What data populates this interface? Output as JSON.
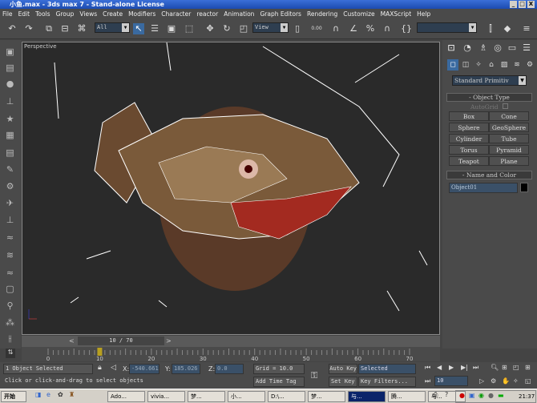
{
  "window": {
    "title": "小鱼.max - 3ds max 7 - Stand-alone License",
    "min": "_",
    "max": "□",
    "close": "X"
  },
  "menu": [
    "File",
    "Edit",
    "Tools",
    "Group",
    "Views",
    "Create",
    "Modifiers",
    "Character",
    "reactor",
    "Animation",
    "Graph Editors",
    "Rendering",
    "Customize",
    "MAXScript",
    "Help"
  ],
  "toolbar": {
    "selection_filter": "All",
    "coord_system": "View",
    "spinner_label": "0.00",
    "named_selection": ""
  },
  "viewport": {
    "label": "Perspective"
  },
  "command_panel": {
    "category": "Standard Primitiv",
    "object_type_title": "Object Type",
    "autogrid": "AutoGrid",
    "buttons": [
      "Box",
      "Cone",
      "Sphere",
      "GeoSphere",
      "Cylinder",
      "Tube",
      "Torus",
      "Pyramid",
      "Teapot",
      "Plane"
    ],
    "name_color_title": "Name and Color",
    "object_name": "Object01",
    "object_color": "#000000"
  },
  "timeline": {
    "frame_label": "10 / 70",
    "ticks": [
      "0",
      "10",
      "20",
      "30",
      "40",
      "50",
      "60",
      "70"
    ],
    "current_frame": 10,
    "total_frames": 70
  },
  "status": {
    "selected": "1 Object Selected",
    "prompt": "Click or click-and-drag to select objects",
    "x_label": "X:",
    "x": "-540.661",
    "y_label": "Y:",
    "y": "185.026",
    "z_label": "Z:",
    "z": "0.0",
    "grid": "Grid = 10.0",
    "add_time_tag": "Add Time Tag",
    "auto_key": "Auto Key",
    "set_key": "Set Key",
    "key_mode": "Selected",
    "key_filters": "Key Filters...",
    "frame": "10"
  },
  "taskbar": {
    "start": "开始",
    "tasks": [
      "Ado...",
      "vivia...",
      "梦...",
      "小...",
      "D:\\...",
      "梦...",
      "与...",
      "腾...",
      "与..."
    ],
    "active_index": 6,
    "clock": "21:37"
  }
}
